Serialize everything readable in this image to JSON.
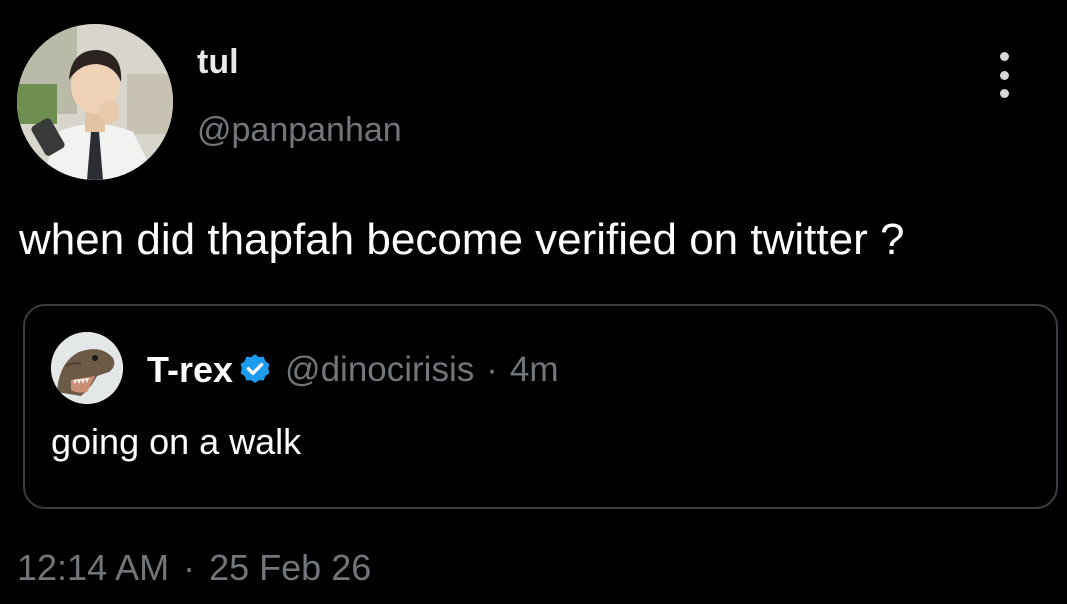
{
  "author": {
    "display_name": "tul",
    "handle": "@panpanhan",
    "avatar_icon": "user-photo-avatar"
  },
  "tweet": {
    "text": "when did thapfah become verified on twitter ?"
  },
  "quote": {
    "display_name": "T-rex",
    "handle": "@dinocirisis",
    "separator": "·",
    "time": "4m",
    "text": "going on a walk",
    "verified_color": "#1d9bf0",
    "avatar_icon": "dinosaur-avatar"
  },
  "footer": {
    "time": "12:14 AM",
    "separator": "·",
    "date": "25 Feb 26"
  },
  "colors": {
    "background": "#000000",
    "primary_text": "#e7e9ea",
    "secondary_text": "#71767b",
    "card_border": "#3a3d41",
    "accent": "#1d9bf0"
  }
}
